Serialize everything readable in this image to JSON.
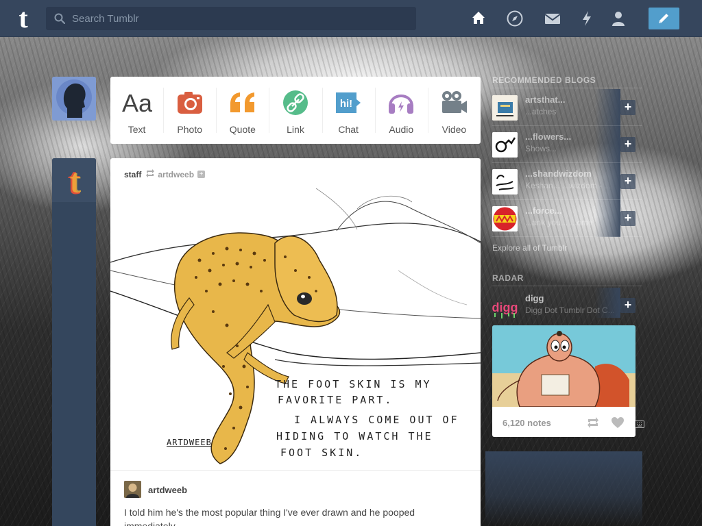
{
  "header": {
    "logo": "t",
    "search_placeholder": "Search Tumblr",
    "nav": [
      "home-icon",
      "explore-icon",
      "inbox-icon",
      "activity-icon",
      "account-icon"
    ],
    "compose": "pencil-icon"
  },
  "post_types": [
    {
      "label": "Text",
      "icon": "text-icon",
      "color": "#444444"
    },
    {
      "label": "Photo",
      "icon": "camera-icon",
      "color": "#d95e40"
    },
    {
      "label": "Quote",
      "icon": "quote-icon",
      "color": "#f2992e"
    },
    {
      "label": "Link",
      "icon": "link-icon",
      "color": "#56bc8a"
    },
    {
      "label": "Chat",
      "icon": "chat-icon",
      "color": "#529ecc"
    },
    {
      "label": "Audio",
      "icon": "headphones-icon",
      "color": "#a77dc2"
    },
    {
      "label": "Video",
      "icon": "video-camera-icon",
      "color": "#748089"
    }
  ],
  "post": {
    "author": "staff",
    "reblogged_from": "artdweeb",
    "image_text": {
      "line1": "THE FOOT SKIN IS MY",
      "line2": "FAVORITE PART.",
      "line3": "I ALWAYS COME OUT OF",
      "line4": "HIDING TO WATCH THE",
      "line5": "FOOT SKIN.",
      "signature": "ARTDWEEB"
    },
    "comment_author": "artdweeb",
    "comment_text": "I told him he's the most popular thing I've ever drawn and he pooped immediately."
  },
  "sidebar": {
    "recommended_title": "RECOMMENDED BLOGS",
    "recommended": [
      {
        "name": "artsthat...",
        "sub": "...atches"
      },
      {
        "name": "...flowers...",
        "sub": "Shows..."
      },
      {
        "name": "...shandwizdom",
        "sub": "Keshan... ...wizdom - ..."
      },
      {
        "name": "...force...",
        "sub": "...ank you... ...ome"
      }
    ],
    "explore": "Explore all of Tumblr",
    "radar_title": "RADAR",
    "radar_blog": "digg",
    "radar_sub": "Digg Dot Tumblr Dot C...",
    "radar_notes": "6,120 notes"
  },
  "colors": {
    "header_bg": "#36465d",
    "compose_bg": "#529ecc"
  }
}
